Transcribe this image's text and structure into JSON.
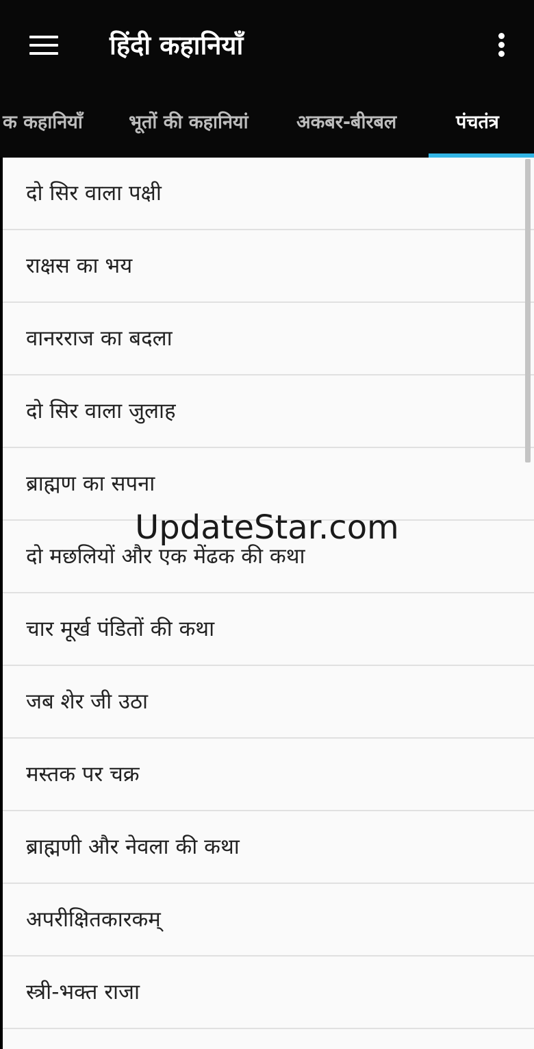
{
  "toolbar": {
    "menu_icon": "hamburger-menu-icon",
    "title": "हिंदी कहानियाँ",
    "overflow_icon": "vertical-more-icon"
  },
  "tabs": [
    {
      "label": "क कहानियाँ",
      "active": false
    },
    {
      "label": "भूतों की कहानियां",
      "active": false
    },
    {
      "label": "अकबर-बीरबल",
      "active": false
    },
    {
      "label": "पंचतंत्र",
      "active": true
    }
  ],
  "stories": [
    "दो सिर वाला पक्षी",
    "राक्षस का भय",
    "वानरराज का बदला",
    "दो सिर वाला जुलाह",
    "ब्राह्मण का सपना",
    "दो मछलियों और एक मेंढक की कथा",
    "चार मूर्ख पंडितों की कथा",
    "जब शेर जी उठा",
    "मस्तक पर चक्र",
    "ब्राह्मणी और नेवला की कथा",
    "अपरीक्षितकारकम्",
    "स्त्री-भक्त राजा"
  ],
  "watermark": "UpdateStar.com",
  "colors": {
    "toolbar_bg": "#080808",
    "tab_indicator": "#33b5e5",
    "list_bg": "#fafafa",
    "divider": "#e0e0e0"
  }
}
